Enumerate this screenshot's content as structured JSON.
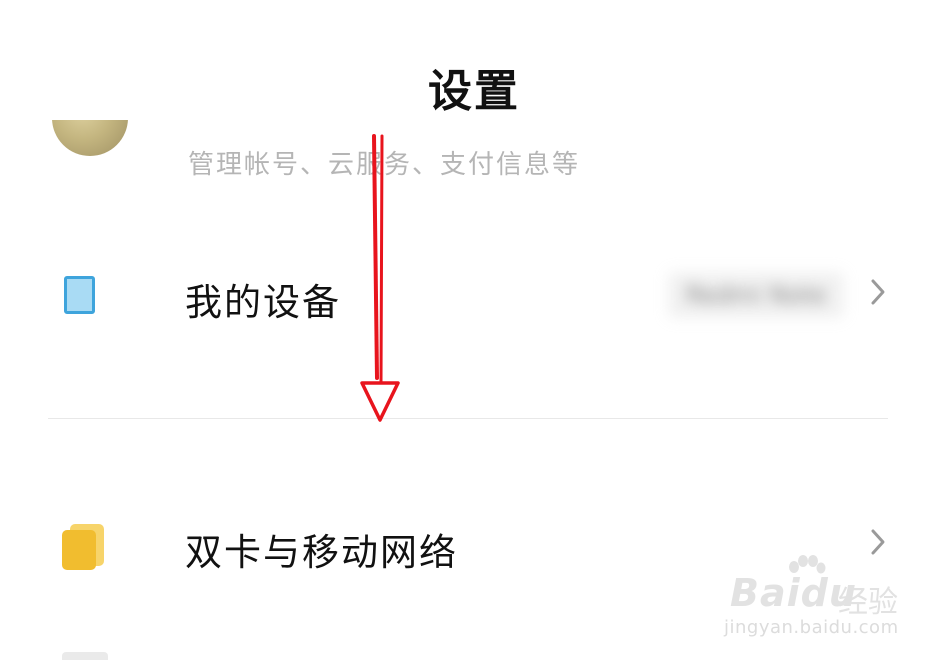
{
  "header": {
    "title": "设置"
  },
  "account": {
    "subtitle": "管理帐号、云服务、支付信息等"
  },
  "items": [
    {
      "label": "我的设备",
      "icon": "device-icon",
      "value": "Redmi Note",
      "value_blurred": true
    },
    {
      "label": "双卡与移动网络",
      "icon": "sim-card-icon"
    }
  ],
  "annotation": {
    "type": "arrow-down",
    "color": "#e8141d"
  },
  "watermark": {
    "brand": "Bai",
    "brand2": "du",
    "product": "经验",
    "url": "jingyan.baidu.com"
  },
  "colors": {
    "device_icon": "#3ea4dc",
    "sim_icon": "#f1bd2f",
    "chevron": "#9a9a9a",
    "divider": "#e8e8e8"
  }
}
